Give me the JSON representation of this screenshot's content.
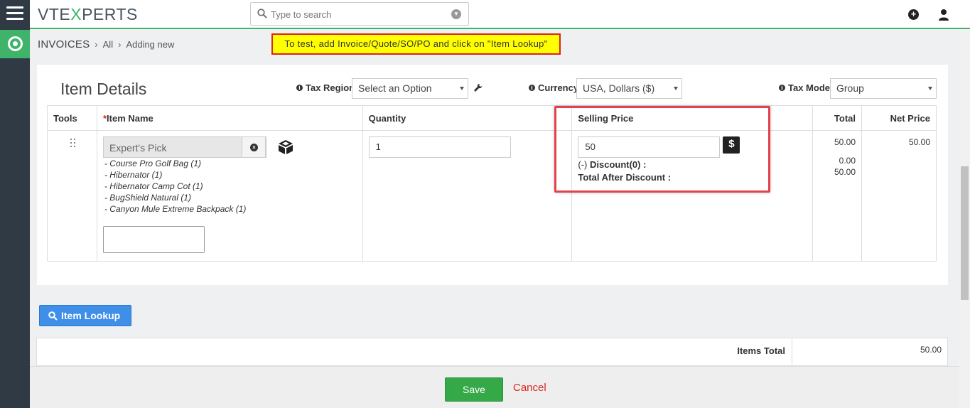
{
  "logo": {
    "part1": "VTE",
    "part2": "X",
    "part3": "PERTS"
  },
  "search": {
    "placeholder": "Type to search"
  },
  "breadcrumb": {
    "module": "INVOICES",
    "filter": "All",
    "action": "Adding new"
  },
  "notice": "To test, add Invoice/Quote/SO/PO and click on \"Item Lookup\"",
  "item_details": {
    "title": "Item Details",
    "tax_region": {
      "label": "Tax Region",
      "value": "Select an Option"
    },
    "currency": {
      "label": "Currency",
      "value": "USA, Dollars ($)"
    },
    "tax_mode": {
      "label": "Tax Mode",
      "value": "Group"
    }
  },
  "table": {
    "headers": {
      "tools": "Tools",
      "required_mark": "*",
      "item_name": "Item Name",
      "quantity": "Quantity",
      "selling_price": "Selling Price",
      "total": "Total",
      "net_price": "Net Price"
    },
    "row": {
      "item_name": "Expert's Pick",
      "bundle_items": [
        "- Course Pro Golf Bag (1)",
        "- Hibernator (1)",
        "- Hibernator Camp Cot (1)",
        "- BugShield Natural (1)",
        "- Canyon Mule Extreme Backpack (1)"
      ],
      "quantity": "1",
      "selling_price": "50",
      "discount_prefix": "(-)",
      "discount_label": "Discount(0) :",
      "total_after_discount_label": "Total After Discount :",
      "total": "50.00",
      "discount_amount": "0.00",
      "total_after_discount": "50.00",
      "net_price": "50.00"
    }
  },
  "item_lookup_button": "Item Lookup",
  "totals": {
    "items_total_label": "Items Total",
    "items_total_value": "50.00"
  },
  "footer": {
    "save": "Save",
    "cancel": "Cancel"
  }
}
